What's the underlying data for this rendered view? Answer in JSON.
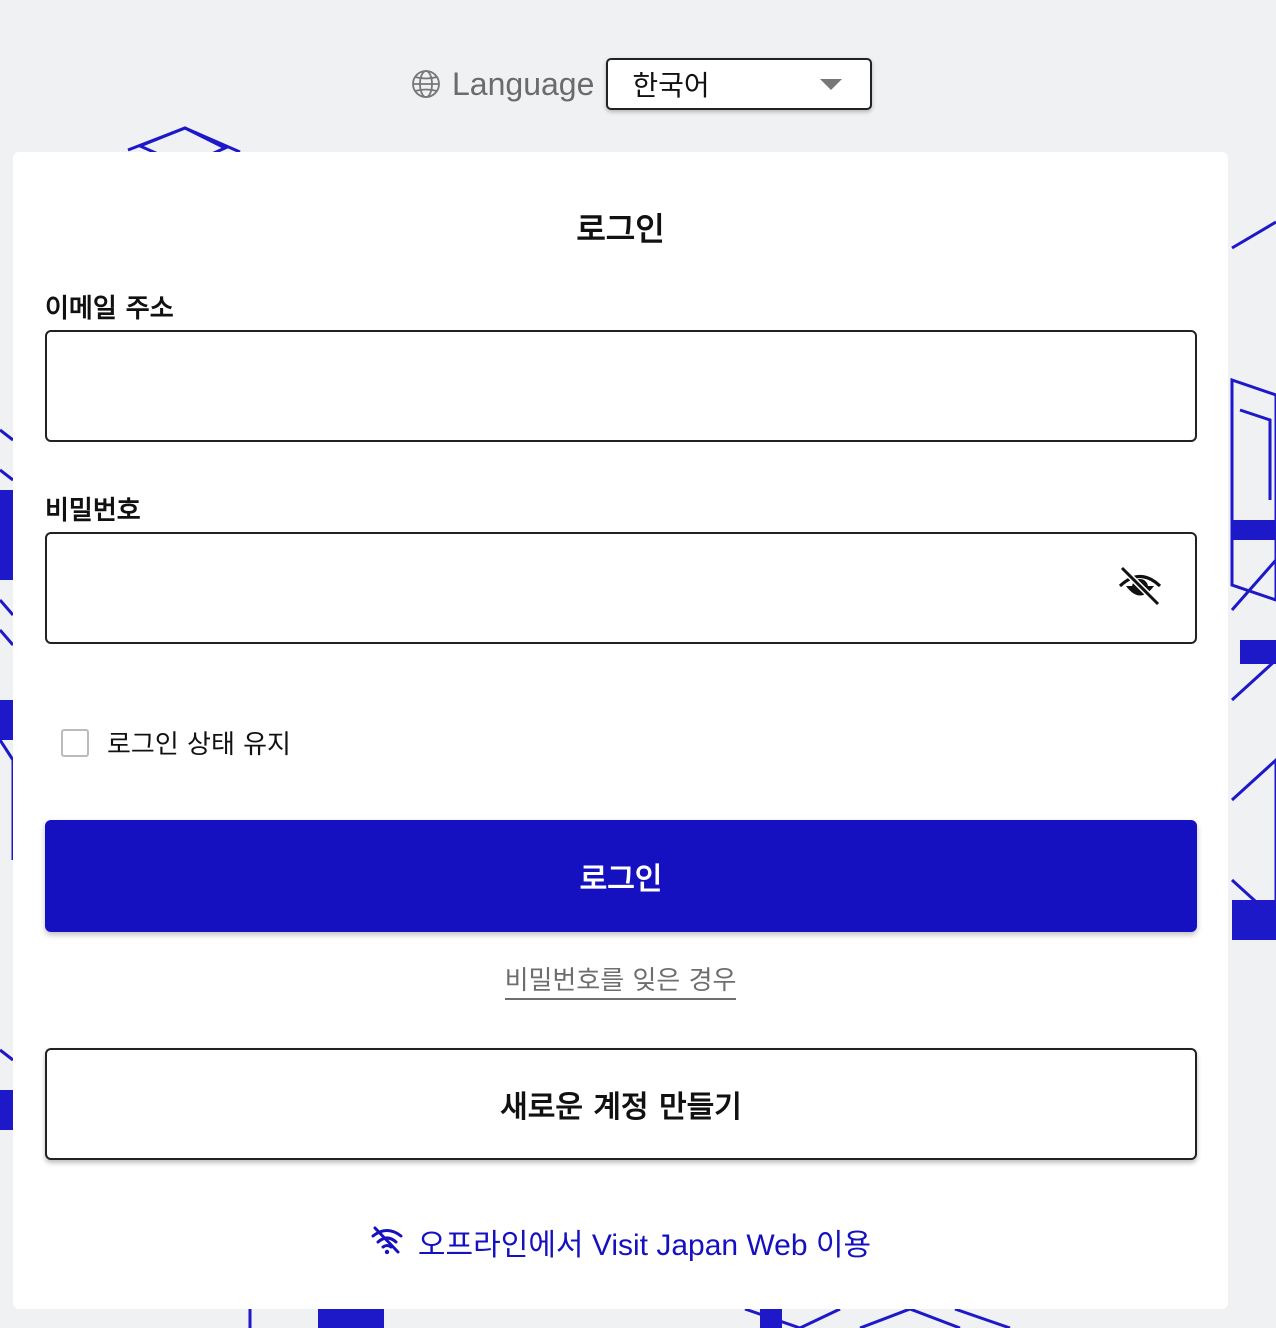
{
  "language": {
    "label": "Language",
    "selected": "한국어",
    "icon": "globe-icon"
  },
  "login": {
    "title": "로그인",
    "email_label": "이메일 주소",
    "email_value": "",
    "password_label": "비밀번호",
    "password_value": "",
    "password_toggle_icon": "eye-off-icon",
    "keep_signed_in_label": "로그인 상태 유지",
    "keep_signed_in_checked": false,
    "submit_label": "로그인",
    "forgot_password_label": "비밀번호를 잊은 경우",
    "create_account_label": "새로운 계정 만들기",
    "offline_label": "오프라인에서 Visit Japan Web 이용",
    "offline_icon": "wifi-off-icon"
  },
  "colors": {
    "primary": "#1510c0",
    "background": "#f0f1f3",
    "card": "#ffffff",
    "link_gray": "#6e6e6e"
  }
}
